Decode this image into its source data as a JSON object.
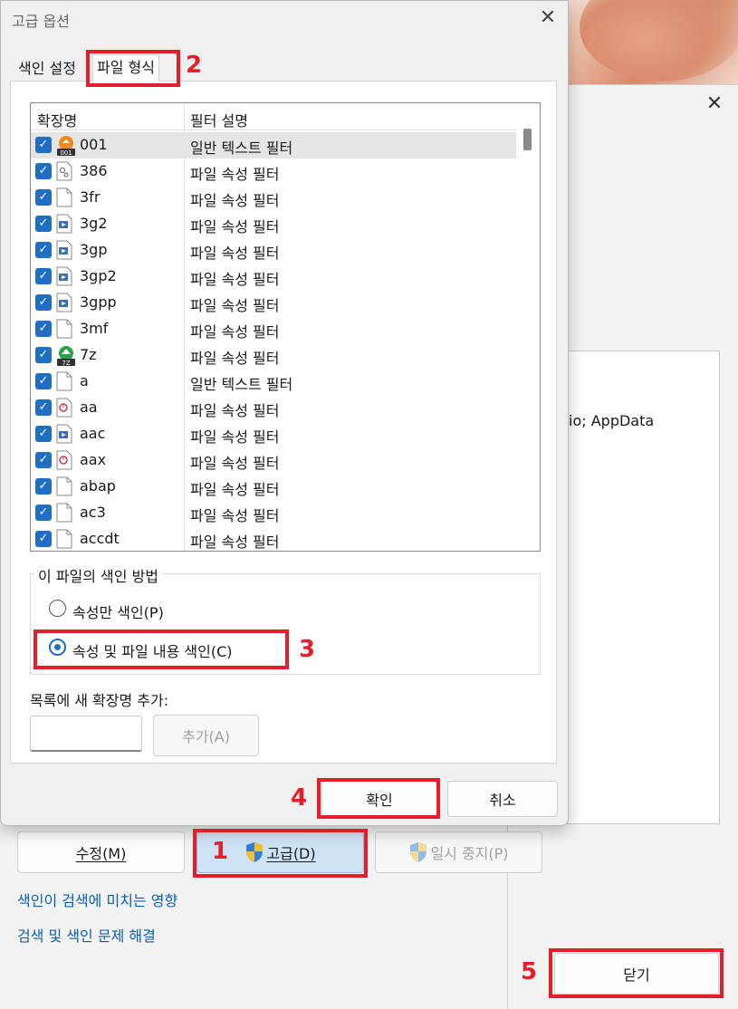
{
  "dialog": {
    "title": "고급 옵션",
    "tabs": [
      "색인 설정",
      "파일 형식"
    ],
    "columns": [
      "확장명",
      "필터 설명"
    ],
    "rows": [
      {
        "ext": "001",
        "filter": "일반 텍스트 필터",
        "icon": "archive-001-icon"
      },
      {
        "ext": "386",
        "filter": "파일 속성 필터",
        "icon": "gear-file-icon"
      },
      {
        "ext": "3fr",
        "filter": "파일 속성 필터",
        "icon": "blank-file-icon"
      },
      {
        "ext": "3g2",
        "filter": "파일 속성 필터",
        "icon": "video-file-icon"
      },
      {
        "ext": "3gp",
        "filter": "파일 속성 필터",
        "icon": "video-file-icon"
      },
      {
        "ext": "3gp2",
        "filter": "파일 속성 필터",
        "icon": "video-file-icon"
      },
      {
        "ext": "3gpp",
        "filter": "파일 속성 필터",
        "icon": "video-file-icon"
      },
      {
        "ext": "3mf",
        "filter": "파일 속성 필터",
        "icon": "blank-file-icon"
      },
      {
        "ext": "7z",
        "filter": "파일 속성 필터",
        "icon": "7z-archive-icon"
      },
      {
        "ext": "a",
        "filter": "일반 텍스트 필터",
        "icon": "blank-file-icon"
      },
      {
        "ext": "aa",
        "filter": "파일 속성 필터",
        "icon": "audio-file-icon"
      },
      {
        "ext": "aac",
        "filter": "파일 속성 필터",
        "icon": "video-file-icon"
      },
      {
        "ext": "aax",
        "filter": "파일 속성 필터",
        "icon": "audio-file-icon"
      },
      {
        "ext": "abap",
        "filter": "파일 속성 필터",
        "icon": "blank-file-icon"
      },
      {
        "ext": "ac3",
        "filter": "파일 속성 필터",
        "icon": "blank-file-icon"
      },
      {
        "ext": "accdt",
        "filter": "파일 속성 필터",
        "icon": "blank-file-icon"
      }
    ],
    "index_method_label": "이 파일의 색인 방법",
    "radio_props_only": "속성만 색인(P)",
    "radio_props_content": "속성 및 파일 내용 색인(C)",
    "add_ext_label": "목록에 새 확장명 추가:",
    "add_ext_value": "",
    "add_button": "추가(A)",
    "ok_button": "확인",
    "cancel_button": "취소"
  },
  "background": {
    "snippet_text": "io; AppData",
    "modify_button": "수정(M)",
    "advanced_button": "고급(D)",
    "pause_button": "일시 중지(P)",
    "link_effect": "색인이 검색에 미치는 영향",
    "link_troubleshoot": "검색 및 색인 문제 해결",
    "close_button": "닫기"
  },
  "annotations": [
    "1",
    "2",
    "3",
    "4",
    "5"
  ],
  "colors": {
    "annotation_red": "#e61e2a",
    "accent_blue": "#1f6fc5",
    "link_blue": "#0a5fb4"
  }
}
